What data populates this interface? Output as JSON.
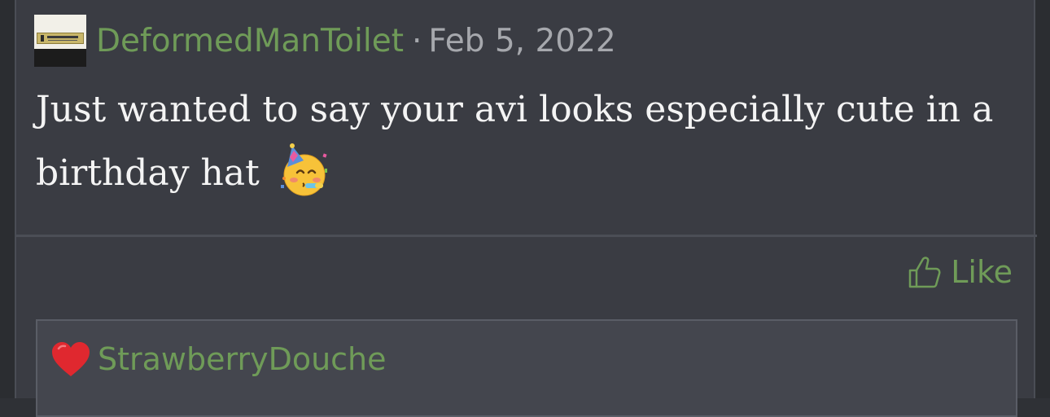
{
  "post": {
    "avatar_icon": "toilet-sign-avatar",
    "username": "DeformedManToilet",
    "separator": "·",
    "date": "Feb 5, 2022",
    "body_line1": "Just wanted to say your avi looks especially cute in a",
    "body_line2": "birthday hat",
    "emoji": "partying-face-emoji"
  },
  "actions": {
    "like_label": "Like",
    "like_icon": "thumbs-up-icon"
  },
  "reply": {
    "heart_icon": "red-heart-icon",
    "username": "StrawberryDouche"
  },
  "colors": {
    "username_green": "#6f9b58",
    "card_bg": "#3a3c43",
    "reply_bg": "#44464e",
    "text": "#f4f4f4",
    "meta": "#a6a8ad",
    "heart": "#e0282f"
  }
}
